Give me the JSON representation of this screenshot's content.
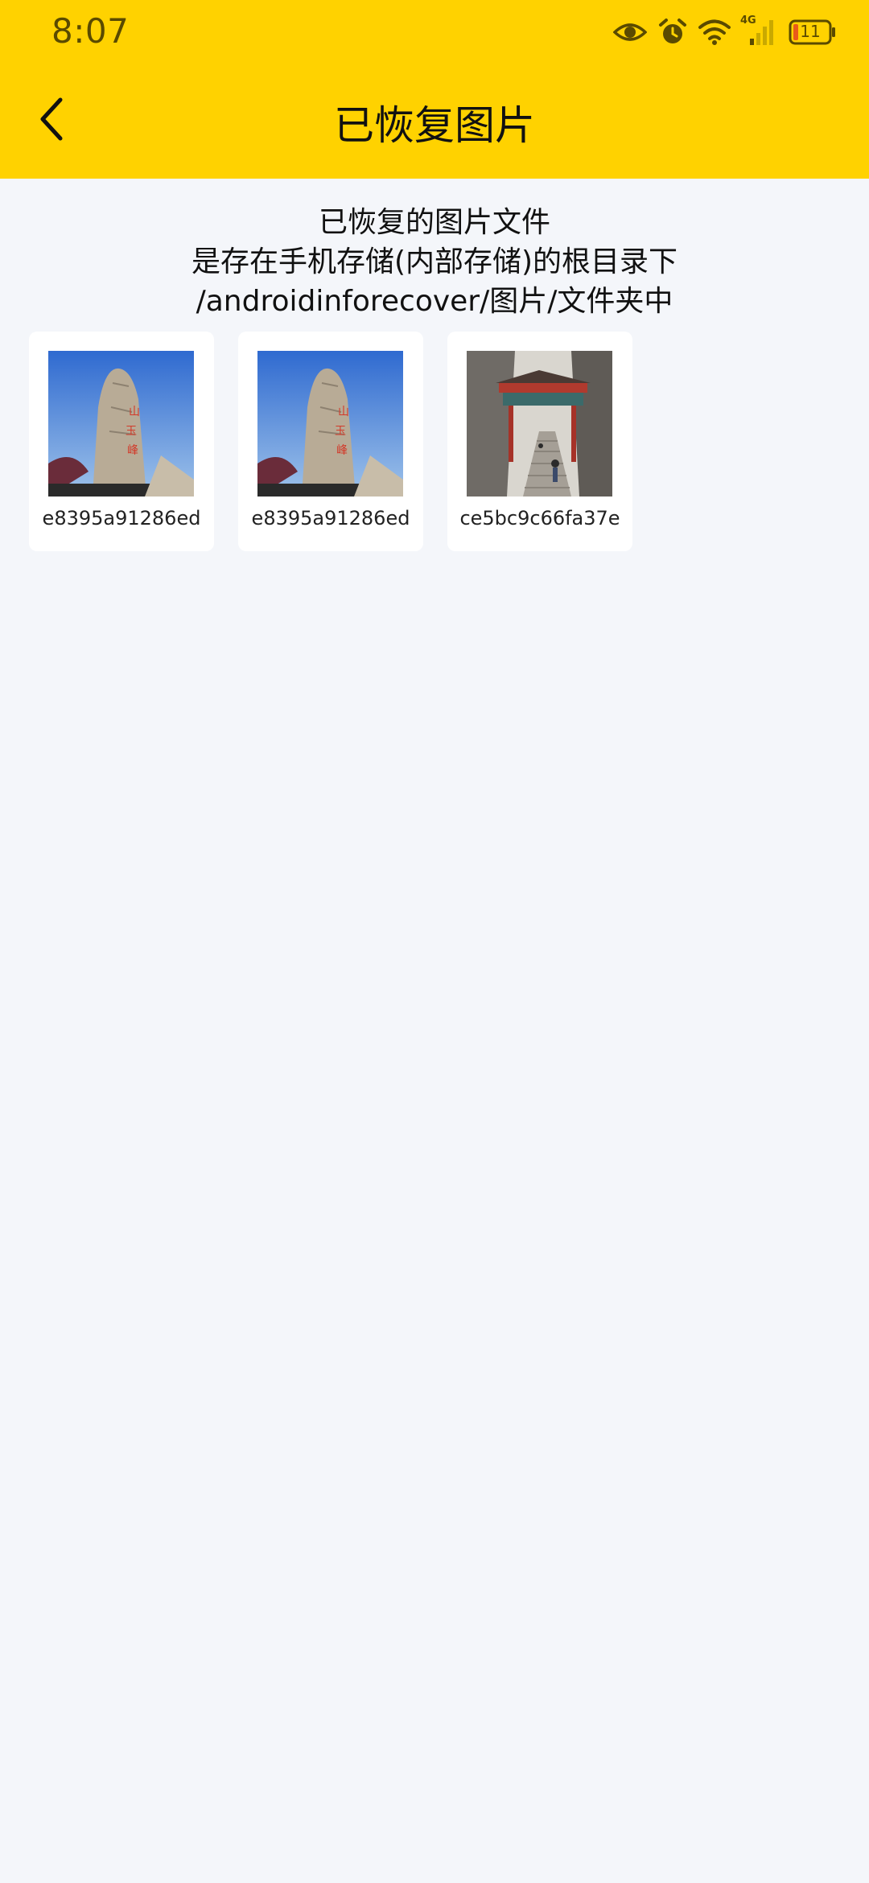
{
  "status_bar": {
    "time": "8:07",
    "battery_level": "11",
    "network_label": "4G",
    "icons": [
      "eye-icon",
      "alarm-icon",
      "wifi-icon",
      "cellular-signal-icon",
      "battery-icon"
    ]
  },
  "header": {
    "title": "已恢复图片",
    "back_icon": "chevron-left-icon"
  },
  "info": {
    "line1": "已恢复的图片文件",
    "line2": "是存在手机存储(内部存储)的根目录下",
    "line3": "/androidinforecover/图片/文件夹中"
  },
  "images": [
    {
      "name": "e8395a91286ed",
      "thumb": "mountain-peak-stone-photo"
    },
    {
      "name": "e8395a91286ed",
      "thumb": "mountain-peak-stone-photo"
    },
    {
      "name": "ce5bc9c66fa37e",
      "thumb": "mountain-gate-stairs-photo"
    }
  ],
  "colors": {
    "accent": "#ffd200",
    "background": "#f4f6fa",
    "card": "#ffffff"
  }
}
